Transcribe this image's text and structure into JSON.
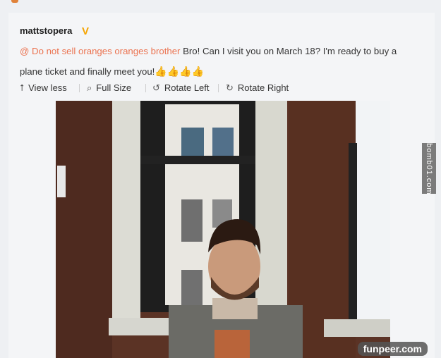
{
  "post": {
    "username": "mattstopera",
    "verified_badge": "V",
    "mention": "@ Do not sell oranges oranges brother",
    "text": " Bro! Can I visit you on March 18? I'm ready to buy a plane ticket and finally meet you!",
    "emoji": [
      "👍",
      "👍",
      "👍",
      "👍"
    ]
  },
  "actions": {
    "view_less": "View less",
    "full_size": "Full Size",
    "rotate_left": "Rotate Left",
    "rotate_right": "Rotate Right"
  },
  "icons": {
    "view_less": "arrow-up-icon",
    "full_size": "search-icon",
    "rotate_left": "rotate-left-icon",
    "rotate_right": "rotate-right-icon"
  },
  "watermarks": {
    "side": "bomb01.com",
    "bottom": "funpeer.com"
  },
  "colors": {
    "mention": "#eb7350",
    "verified": "#f5a400",
    "background": "#f4f5f7"
  }
}
